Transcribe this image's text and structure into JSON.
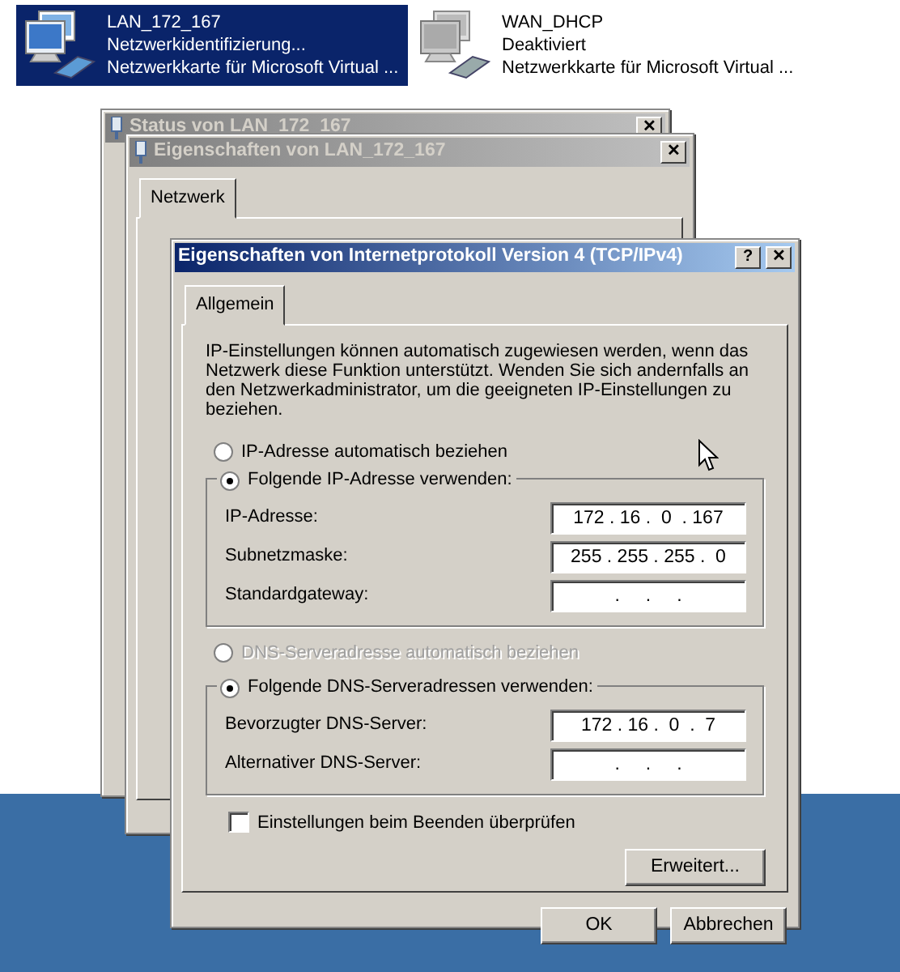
{
  "connections": [
    {
      "name": "LAN_172_167",
      "status": "Netzwerkidentifizierung...",
      "adapter": "Netzwerkkarte für Microsoft Virtual ...",
      "selected": true,
      "disabled": false
    },
    {
      "name": "WAN_DHCP",
      "status": "Deaktiviert",
      "adapter": "Netzwerkkarte für Microsoft Virtual ...",
      "selected": false,
      "disabled": true
    }
  ],
  "background_windows": [
    {
      "title": "Status von LAN_172_167"
    },
    {
      "title": "Eigenschaften von LAN_172_167",
      "tabs": [
        {
          "label": "Netzwerk",
          "selected": true
        }
      ]
    }
  ],
  "dialog": {
    "title": "Eigenschaften von Internetprotokoll Version 4 (TCP/IPv4)",
    "help": "?",
    "close": "✕",
    "tabs": [
      {
        "label": "Allgemein",
        "selected": true
      }
    ],
    "description": "IP-Einstellungen können automatisch zugewiesen werden, wenn das Netzwerk diese Funktion unterstützt. Wenden Sie sich andernfalls an den Netzwerkadministrator, um die geeigneten IP-Einstellungen zu beziehen.",
    "sections": [
      {
        "auto": {
          "label": "IP-Adresse automatisch beziehen",
          "selected": false,
          "disabled": false
        },
        "manual": {
          "label": "Folgende IP-Adresse verwenden:",
          "selected": true,
          "disabled": false
        },
        "fields": [
          {
            "label": "IP-Adresse:",
            "value": "172 . 16 .  0  . 167"
          },
          {
            "label": "Subnetzmaske:",
            "value": "255 . 255 . 255 .  0"
          },
          {
            "label": "Standardgateway:",
            "value": "   .     .     .   "
          }
        ]
      },
      {
        "auto": {
          "label": "DNS-Serveradresse automatisch beziehen",
          "selected": false,
          "disabled": true
        },
        "manual": {
          "label": "Folgende DNS-Serveradressen verwenden:",
          "selected": true,
          "disabled": false
        },
        "fields": [
          {
            "label": "Bevorzugter DNS-Server:",
            "value": "172 . 16 .  0  .  7"
          },
          {
            "label": "Alternativer DNS-Server:",
            "value": "   .     .     .   "
          }
        ]
      }
    ],
    "check": {
      "label": "Einstellungen beim Beenden überprüfen",
      "checked": false
    },
    "advanced_button": "Erweitert...",
    "buttons": [
      "OK",
      "Abbrechen"
    ]
  }
}
